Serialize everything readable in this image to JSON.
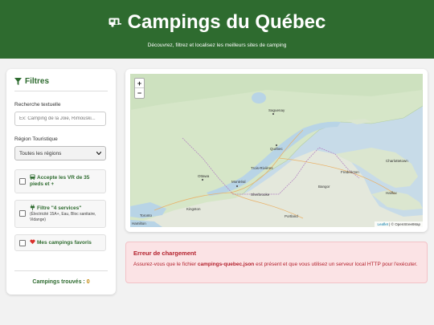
{
  "header": {
    "title": "Campings du Québec",
    "subtitle": "Découvrez, filtrez et localisez les meilleurs sites de camping"
  },
  "sidebar": {
    "title": "Filtres",
    "search_label": "Recherche textuelle",
    "search_placeholder": "Ex: Camping de la Joie, Rimouski...",
    "region_label": "Région Touristique",
    "region_selected": "Toutes les régions",
    "options": [
      {
        "label": "Accepte les VR de 35 pieds et +",
        "icon": "rv-icon"
      },
      {
        "label": "Filtre \"4 services\"",
        "detail": "(Électricité 15A+, Eau, Bloc sanitaire, Vidange)",
        "icon": "plug-icon"
      },
      {
        "label": "Mes campings favoris",
        "icon": "heart-icon"
      }
    ],
    "count_label": "Campings trouvés :",
    "count_value": "0"
  },
  "map": {
    "zoom_in": "+",
    "zoom_out": "−",
    "attribution_leaflet": "Leaflet",
    "attribution_osm": "| © OpenStreetMap",
    "cities": {
      "saguenay": "Saguenay",
      "quebec": "Québec",
      "ottawa": "Ottawa",
      "montreal": "Montréal",
      "sherbrooke": "Sherbrooke",
      "toronto": "Toronto",
      "kingston": "Kingston",
      "hamilton": "Hamilton",
      "portland": "Portland",
      "fredericton": "Fredericton",
      "halifax": "Halifax",
      "charlottetown": "Charlottetown",
      "trois_rivieres": "Trois-Rivières",
      "bangor": "Bangor"
    }
  },
  "error": {
    "title": "Erreur de chargement",
    "msg_prefix": "Assurez-vous que le fichier ",
    "msg_file": "campings-quebec.json",
    "msg_suffix": " est présent et que vous utilisez un serveur local HTTP pour l'exécuter."
  },
  "colors": {
    "brand_green": "#2e6b2f",
    "error_red": "#b3202c",
    "count_accent": "#c08400"
  }
}
